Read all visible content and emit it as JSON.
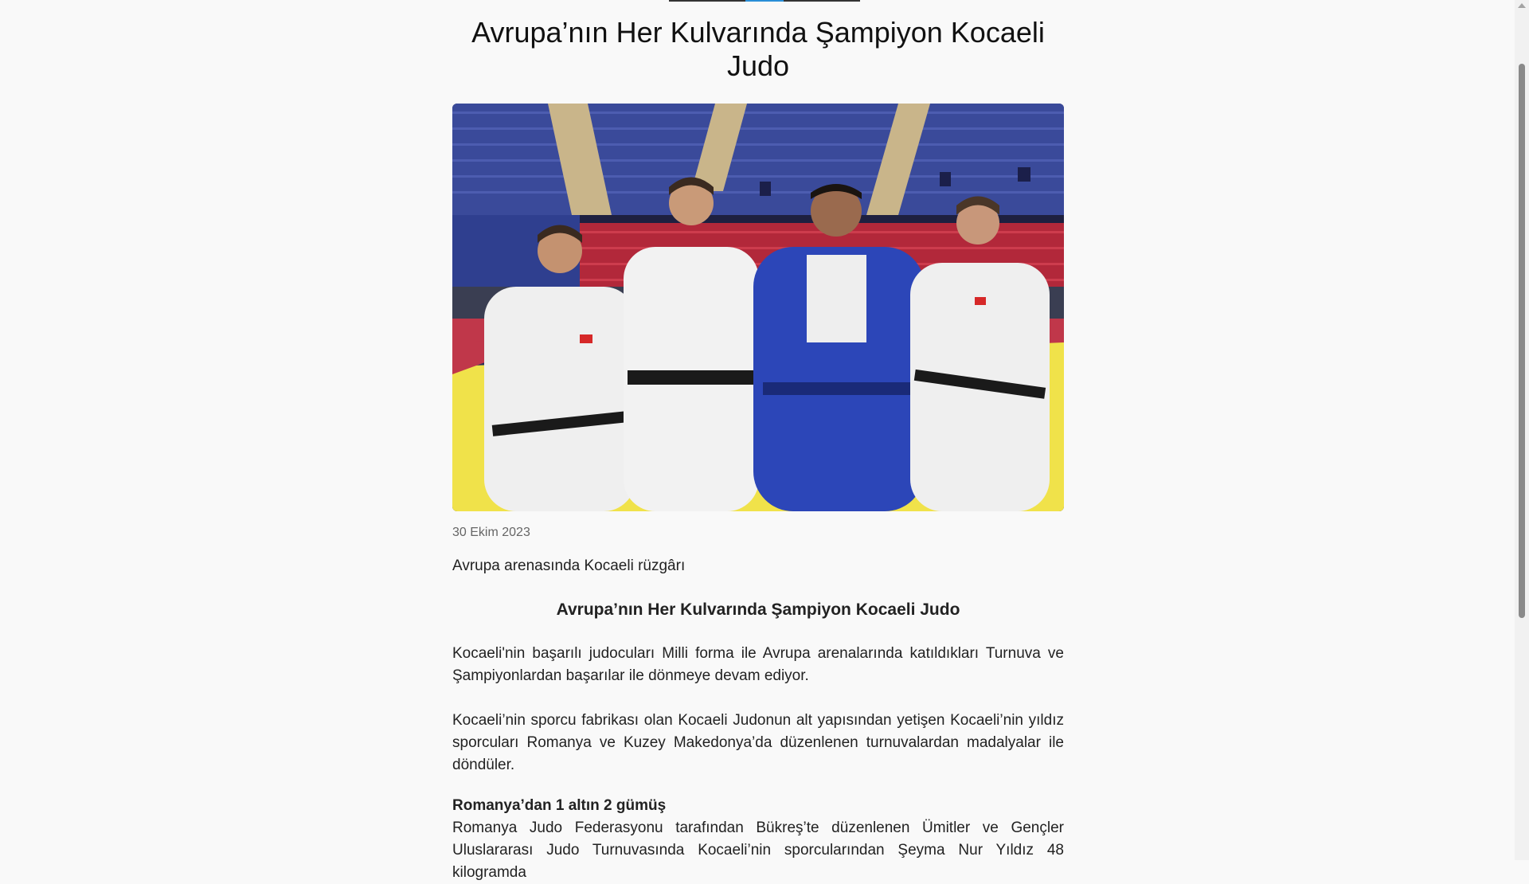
{
  "article": {
    "title": "Avrupa’nın Her Kulvarında Şampiyon Kocaeli Judo",
    "image_alt": "Kocaeli judo sporcuları",
    "date": "30 Ekim 2023",
    "subtitle": "Avrupa arenasında Kocaeli rüzgârı",
    "section_heading": "Avrupa’nın Her Kulvarında Şampiyon Kocaeli Judo",
    "paragraphs": [
      "Kocaeli'nin başarılı judocuları Milli forma ile Avrupa arenalarında katıldıkları Turnuva ve Şampiyonlardan başarılar ile dönmeye devam ediyor.",
      "Kocaeli’nin sporcu fabrikası olan Kocaeli Judonun alt yapısından yetişen Kocaeli’nin yıldız sporcuları Romanya ve Kuzey Makedonya’da düzenlenen turnuvalardan madalyalar ile döndüler."
    ],
    "romania_heading": "Romanya’dan 1 altın 2 gümüş",
    "romania_paragraph": "Romanya Judo Federasyonu tarafından Bükreş’te düzenlenen Ümitler ve Gençler Uluslararası Judo Turnuvasında Kocaeli’nin sporcularından Şeyma Nur Yıldız 48 kilogramda"
  },
  "colors": {
    "background": "#f9f9f9",
    "accent": "#2a8fd8",
    "text": "#222222"
  }
}
